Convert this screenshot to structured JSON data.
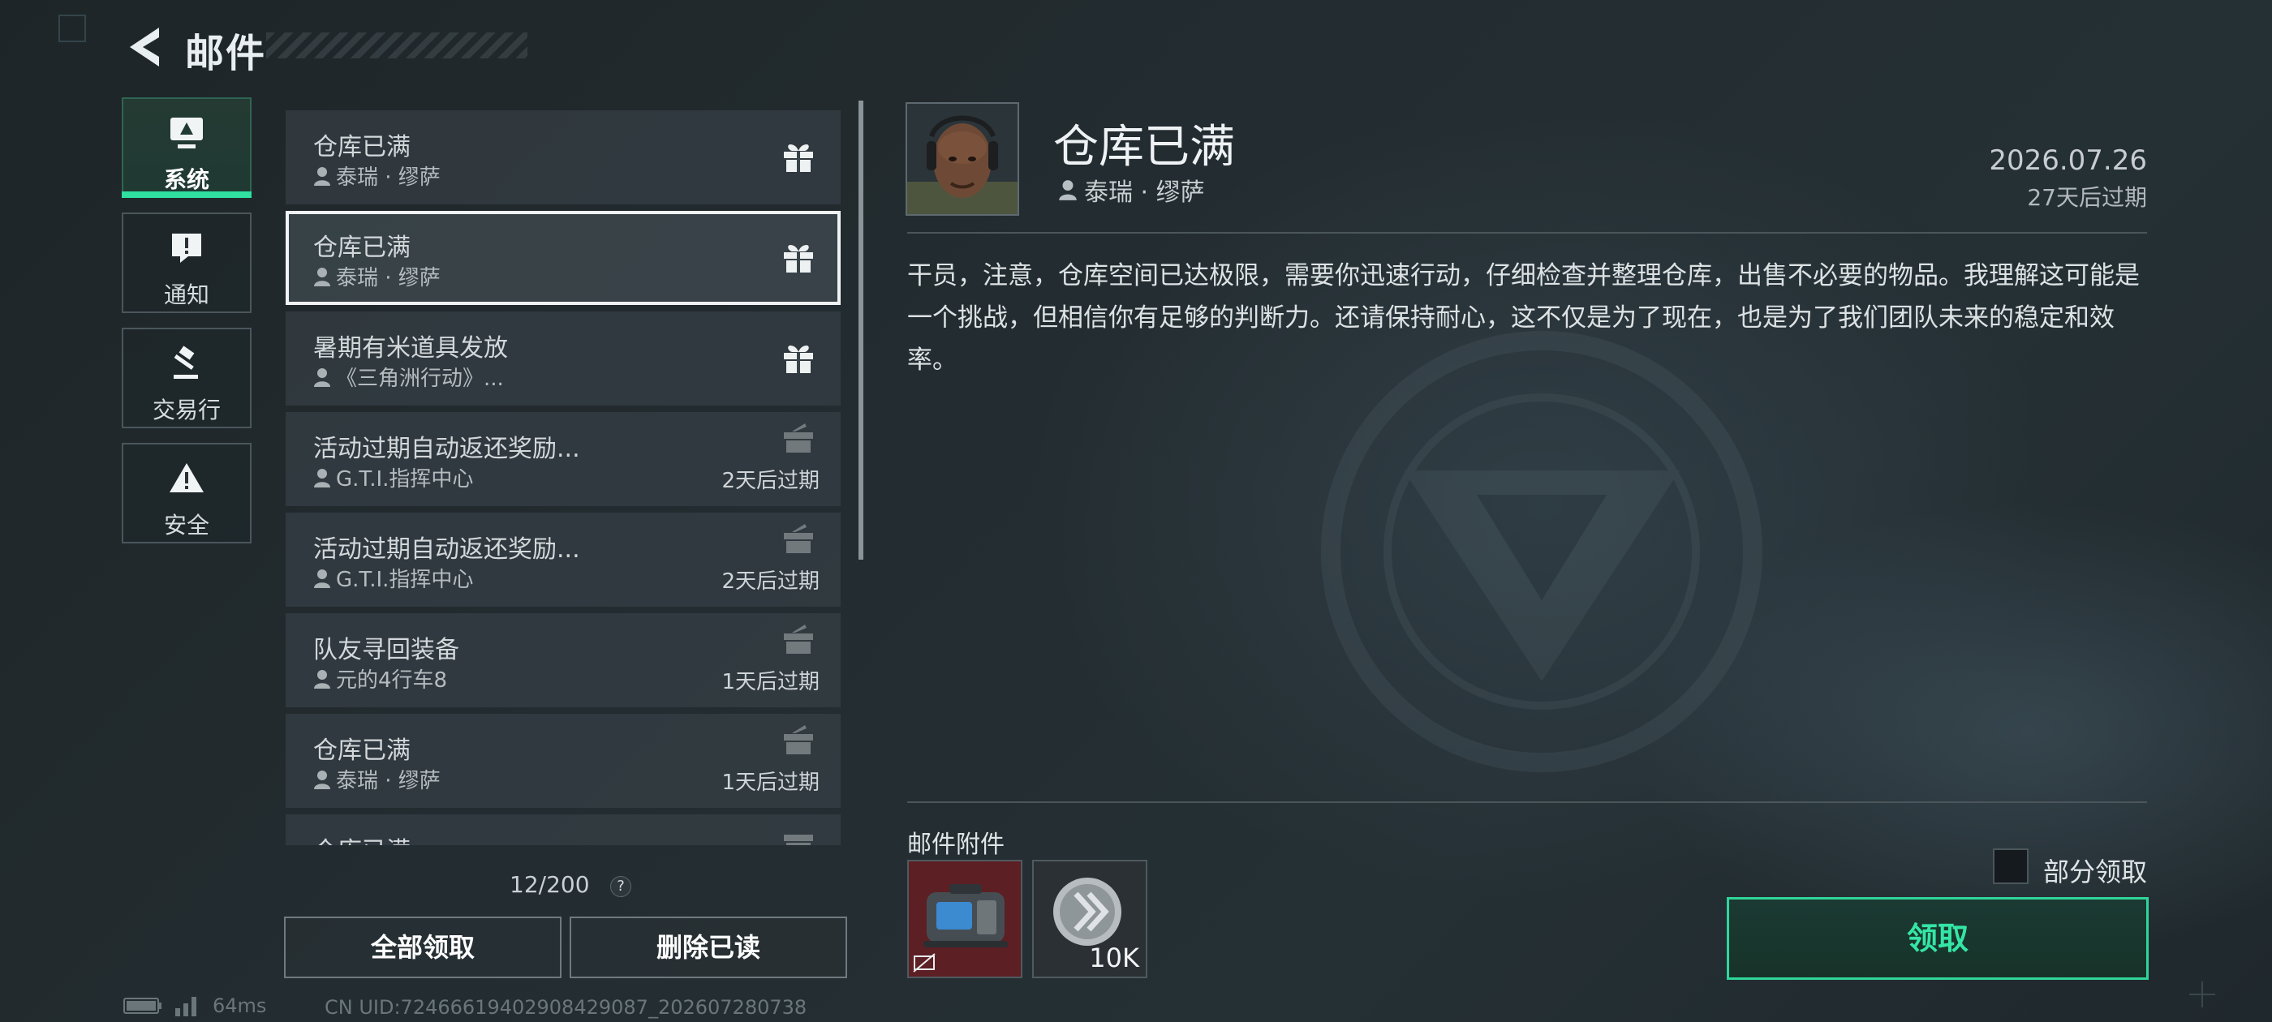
{
  "header": {
    "title": "邮件"
  },
  "categories": [
    {
      "label": "系统",
      "icon": "system-monitor-icon",
      "active": true
    },
    {
      "label": "通知",
      "icon": "notification-alert-icon",
      "active": false
    },
    {
      "label": "交易行",
      "icon": "auction-gavel-icon",
      "active": false
    },
    {
      "label": "安全",
      "icon": "warning-triangle-icon",
      "active": false
    }
  ],
  "mail_list": {
    "items": [
      {
        "title": "仓库已满",
        "sender": "泰瑞 · 缪萨",
        "expire": "",
        "gift": "active",
        "selected": false
      },
      {
        "title": "仓库已满",
        "sender": "泰瑞 · 缪萨",
        "expire": "",
        "gift": "active",
        "selected": true
      },
      {
        "title": "暑期有米道具发放",
        "sender": "《三角洲行动》...",
        "expire": "",
        "gift": "active",
        "selected": false
      },
      {
        "title": "活动过期自动返还奖励...",
        "sender": "G.T.I.指挥中心",
        "expire": "2天后过期",
        "gift": "claimed",
        "selected": false
      },
      {
        "title": "活动过期自动返还奖励...",
        "sender": "G.T.I.指挥中心",
        "expire": "2天后过期",
        "gift": "claimed",
        "selected": false
      },
      {
        "title": "队友寻回装备",
        "sender": "元的4行车8",
        "expire": "1天后过期",
        "gift": "claimed",
        "selected": false
      },
      {
        "title": "仓库已满",
        "sender": "泰瑞 · 缪萨",
        "expire": "1天后过期",
        "gift": "claimed",
        "selected": false
      },
      {
        "title": "仓库已满",
        "sender": "",
        "expire": "",
        "gift": "claimed",
        "selected": false
      }
    ],
    "count": "12/200",
    "help": "?"
  },
  "actions": {
    "claim_all": "全部领取",
    "delete_read": "删除已读"
  },
  "status": {
    "ping": "64ms",
    "uid": "CN UID:7246661940290842908​7_202607280738"
  },
  "detail": {
    "title": "仓库已满",
    "sender": "泰瑞 · 缪萨",
    "date": "2026.07.26",
    "expire": "27天后过期",
    "body": "干员，注意，仓库空间已达极限，需要你迅速行动，仔细检查并整理仓库，出售不必要的物品。我理解这可能是一个挑战，但相信你有足够的判断力。还请保持耐心，这不仅是为了现在，也是为了我们团队未来的稳定和效率。",
    "attachments_label": "邮件附件",
    "attachments": [
      {
        "icon": "equipment-case-icon",
        "count": ""
      },
      {
        "icon": "currency-coin-icon",
        "count": "10K"
      }
    ],
    "partial_claim_label": "部分领取",
    "claim_label": "领取"
  },
  "colors": {
    "accent": "#2fe0a0",
    "selected_border": "#f0f2f3",
    "attachment_red": "#5c1f24"
  }
}
